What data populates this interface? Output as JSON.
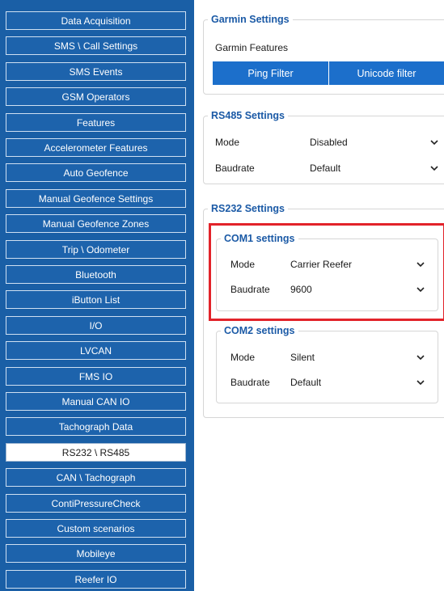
{
  "sidebar": {
    "items": [
      {
        "label": "Data Acquisition",
        "active": false
      },
      {
        "label": "SMS \\ Call Settings",
        "active": false
      },
      {
        "label": "SMS Events",
        "active": false
      },
      {
        "label": "GSM Operators",
        "active": false
      },
      {
        "label": "Features",
        "active": false
      },
      {
        "label": "Accelerometer Features",
        "active": false
      },
      {
        "label": "Auto Geofence",
        "active": false
      },
      {
        "label": "Manual Geofence Settings",
        "active": false
      },
      {
        "label": "Manual Geofence Zones",
        "active": false
      },
      {
        "label": "Trip \\ Odometer",
        "active": false
      },
      {
        "label": "Bluetooth",
        "active": false
      },
      {
        "label": "iButton List",
        "active": false
      },
      {
        "label": "I/O",
        "active": false
      },
      {
        "label": "LVCAN",
        "active": false
      },
      {
        "label": "FMS IO",
        "active": false
      },
      {
        "label": "Manual CAN IO",
        "active": false
      },
      {
        "label": "Tachograph Data",
        "active": false
      },
      {
        "label": "RS232 \\ RS485",
        "active": true
      },
      {
        "label": "CAN \\ Tachograph",
        "active": false
      },
      {
        "label": "ContiPressureCheck",
        "active": false
      },
      {
        "label": "Custom scenarios",
        "active": false
      },
      {
        "label": "Mobileye",
        "active": false
      },
      {
        "label": "Reefer IO",
        "active": false
      }
    ]
  },
  "garmin": {
    "title": "Garmin Settings",
    "features_label": "Garmin Features",
    "tabs": [
      "Ping Filter",
      "Unicode filter"
    ]
  },
  "rs485": {
    "title": "RS485 Settings",
    "mode_label": "Mode",
    "mode_value": "Disabled",
    "baud_label": "Baudrate",
    "baud_value": "Default"
  },
  "rs232": {
    "title": "RS232 Settings",
    "com1": {
      "title": "COM1 settings",
      "mode_label": "Mode",
      "mode_value": "Carrier Reefer",
      "baud_label": "Baudrate",
      "baud_value": "9600"
    },
    "com2": {
      "title": "COM2 settings",
      "mode_label": "Mode",
      "mode_value": "Silent",
      "baud_label": "Baudrate",
      "baud_value": "Default"
    }
  },
  "colors": {
    "sidebar_bg": "#1a5fa6",
    "accent": "#1b5aa6",
    "tab_bg": "#1c6fcb",
    "highlight": "#e2232a"
  }
}
